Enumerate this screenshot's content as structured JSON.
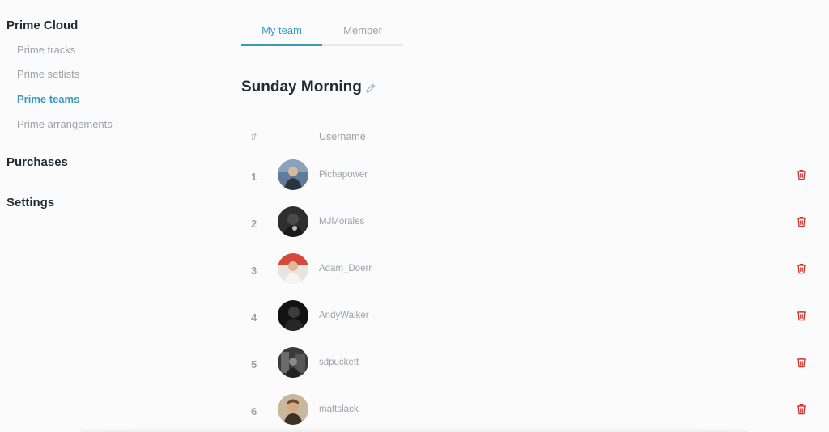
{
  "sidebar": {
    "sections": [
      {
        "label": "Prime Cloud"
      },
      {
        "label": "Purchases"
      },
      {
        "label": "Settings"
      }
    ],
    "items": [
      {
        "label": "Prime tracks"
      },
      {
        "label": "Prime setlists"
      },
      {
        "label": "Prime teams"
      },
      {
        "label": "Prime arrangements"
      }
    ]
  },
  "tabs": [
    {
      "label": "My team"
    },
    {
      "label": "Member"
    }
  ],
  "team": {
    "title": "Sunday Morning"
  },
  "table": {
    "headers": {
      "number": "#",
      "username": "Username"
    },
    "rows": [
      {
        "num": "1",
        "username": "Pichapower"
      },
      {
        "num": "2",
        "username": "MJMorales"
      },
      {
        "num": "3",
        "username": "Adam_Doerr"
      },
      {
        "num": "4",
        "username": "AndyWalker"
      },
      {
        "num": "5",
        "username": "sdpuckett"
      },
      {
        "num": "6",
        "username": "mattslack"
      }
    ]
  },
  "colors": {
    "accent": "#3a9bbf",
    "delete": "#d0312d",
    "muted": "#9aa3a8",
    "heading": "#1f2a33"
  },
  "icons": {
    "edit": "pencil-icon",
    "delete": "trash-icon",
    "avatar": "user-avatar"
  }
}
